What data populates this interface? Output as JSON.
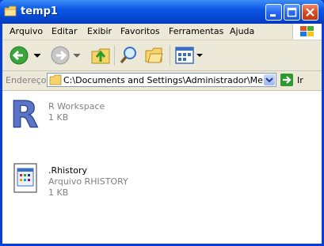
{
  "window": {
    "title": "temp1"
  },
  "menu": [
    "Arquivo",
    "Editar",
    "Exibir",
    "Favoritos",
    "Ferramentas",
    "Ajuda"
  ],
  "toolbar": {
    "back_icon": "back-arrow-icon",
    "forward_icon": "forward-arrow-icon",
    "up_icon": "folder-up-icon",
    "search_icon": "search-icon",
    "folders_icon": "folders-icon",
    "views_icon": "views-icon"
  },
  "address": {
    "label": "Endereço",
    "path": "C:\\Documents and Settings\\Administrador\\Meus doc",
    "go_label": "Ir"
  },
  "files": [
    {
      "name": "R Workspace",
      "lines": [
        "R Workspace",
        "1 KB"
      ],
      "icon": "r-workspace-icon"
    },
    {
      "name": ".Rhistory",
      "lines": [
        ".Rhistory",
        "Arquivo RHISTORY",
        "1 KB"
      ],
      "icon": "rhistory-file-icon"
    }
  ],
  "colors": {
    "titlebar": "#0a58e6",
    "frame": "#ece9d8",
    "accent_blue": "#1f4fd0",
    "green_go": "#2e9a2e"
  }
}
